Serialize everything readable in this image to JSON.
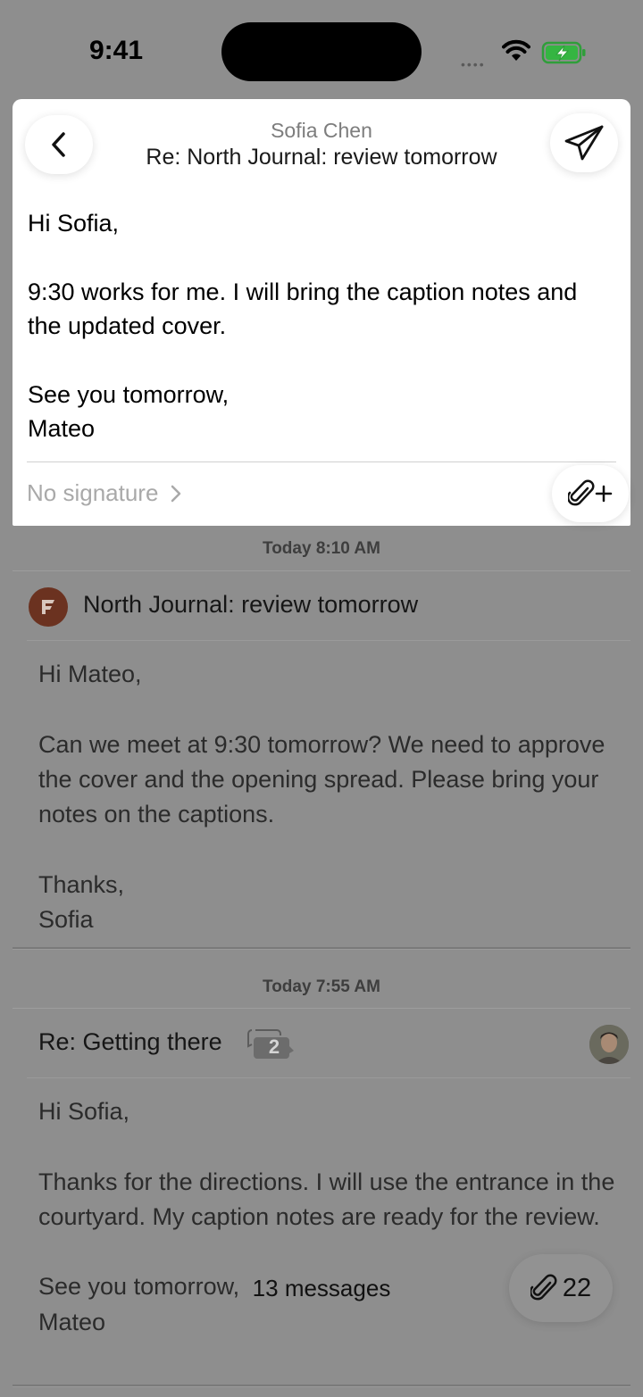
{
  "status": {
    "time": "9:41"
  },
  "compose": {
    "from": "Sofia Chen",
    "subject": "Re: North Journal: review tomorrow",
    "body": [
      "Hi Sofia,",
      "9:30 works for me. I will bring the caption notes and the updated cover.",
      "See you tomorrow,",
      "Mateo"
    ],
    "signature": "No signature"
  },
  "messages": [
    {
      "timestamp": "Today 8:10 AM",
      "subject": "North Journal: review tomorrow",
      "body": [
        "Hi Mateo,",
        "Can we meet at 9:30 tomorrow? We need to approve the cover and the opening spread. Please bring your notes on the captions.",
        "Thanks,",
        "Sofia"
      ]
    },
    {
      "timestamp": "Today 7:55 AM",
      "subject": "Re: Getting there",
      "thread_count": "2",
      "body": [
        "Hi Sofia,",
        "Thanks for the directions. I will use the entrance in the courtyard. My caption notes are ready for the review.",
        "See you tomorrow,",
        "Mateo"
      ]
    }
  ],
  "footer": {
    "message_count": "13 messages",
    "attachment_count": "22"
  }
}
